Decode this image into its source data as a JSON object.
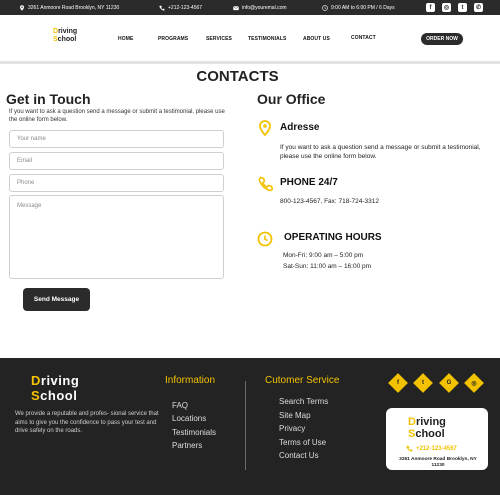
{
  "topbar": {
    "address": "3261 Anmoore Road Brooklyn, NY 11230",
    "phone": "+212-123-4567",
    "email": "info@youremal.com",
    "hours": "9:00 AM to 6:00 PM / 6 Days",
    "social": [
      "facebook-icon",
      "instagram-icon",
      "twitter-icon",
      "whatsapp-icon"
    ]
  },
  "header": {
    "logo_line1": "riving",
    "logo_line1_initial": "D",
    "logo_line2": "chool",
    "logo_line2_initial": "S",
    "nav": [
      "HOME",
      "PROGRAMS",
      "SERVICES",
      "TESTIMONIALS",
      "ABOUT US",
      "CONTACT"
    ],
    "order_label": "ORDER NOW"
  },
  "page": {
    "title": "CONTACTS"
  },
  "touch": {
    "title": "Get in Touch",
    "text": "If you want to ask a question send a message or submit a testimonial, please use the online form below.",
    "name_placeholder": "Your name",
    "email_placeholder": "Email",
    "phone_placeholder": "Phone",
    "message_placeholder": "Message",
    "send_label": "Send Message"
  },
  "office": {
    "title": "Our Office",
    "address_heading": "Adresse",
    "address_text": "If you want to ask a question send a message or submit a testimonial, please use the online form below.",
    "phone_heading": "PHONE 24/7",
    "phone_text": "800-123-4567, Fax: 718-724-3312",
    "hours_heading": "OPERATING HOURS",
    "hours_line1": "Mon-Fri: 9:00 am – 5:00 pm",
    "hours_line2": "Sat-Sun: 11:00 am – 16:00 pm"
  },
  "footer": {
    "description": "We provide a reputable and profes- sional service that aims to give you the confidence to pass your test and drive safely on the roads.",
    "info_heading": "Information",
    "info_links": [
      "FAQ",
      "Locations",
      "Testimonials",
      "Partners"
    ],
    "service_heading": "Cutomer Service",
    "service_links": [
      "Search Terms",
      "Site Map",
      "Privacy",
      "Terms of Use",
      "Contact Us"
    ],
    "card_phone": "+212-123-4567",
    "card_address": "3261 Anmoore Road Brooklyn, NY 11230"
  },
  "colors": {
    "accent": "#f2c200",
    "dark": "#232323"
  }
}
